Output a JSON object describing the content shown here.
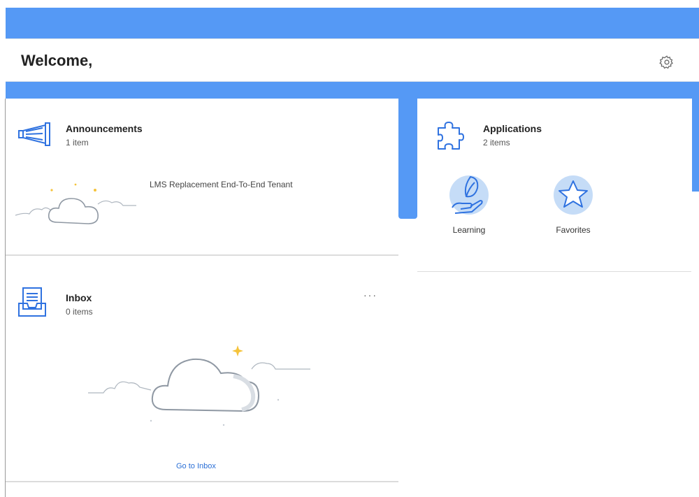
{
  "header": {
    "welcome_text": "Welcome,",
    "settings_icon": "gear-icon"
  },
  "announcements": {
    "title": "Announcements",
    "count": "1 item",
    "icon": "megaphone-icon",
    "items": [
      "LMS Replacement End-To-End Tenant"
    ]
  },
  "inbox": {
    "title": "Inbox",
    "count": "0 items",
    "icon": "inbox-icon",
    "more_label": "···",
    "link_label": "Go to Inbox"
  },
  "applications": {
    "title": "Applications",
    "count": "2 items",
    "icon": "puzzle-icon",
    "apps": [
      {
        "label": "Learning",
        "icon": "learning-icon"
      },
      {
        "label": "Favorites",
        "icon": "star-icon"
      }
    ]
  },
  "colors": {
    "brand_blue": "#5599f5",
    "link_blue": "#2a6fd6",
    "icon_blue": "#2f72e0",
    "icon_bg": "#c5dcf7"
  }
}
